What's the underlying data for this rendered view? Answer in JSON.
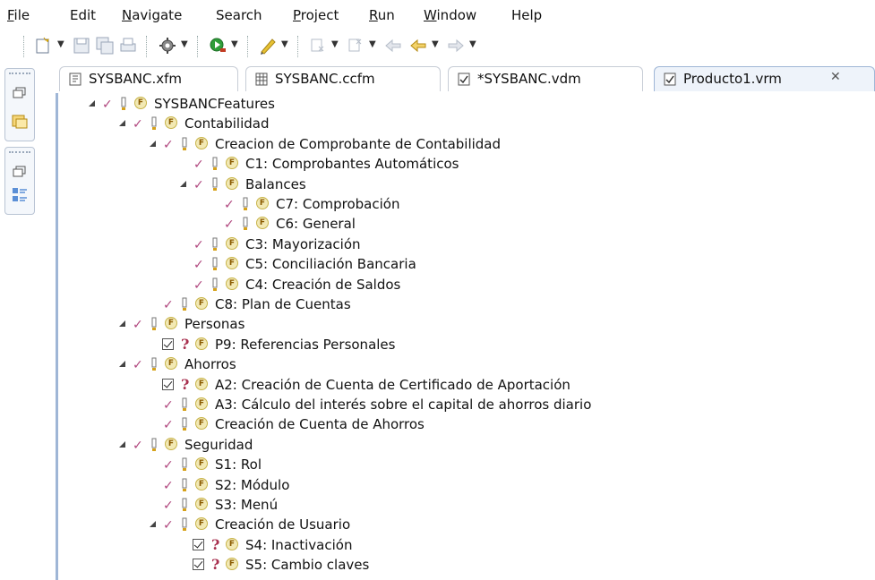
{
  "menu": [
    "File",
    "Edit",
    "Navigate",
    "Search",
    "Project",
    "Run",
    "Window",
    "Help"
  ],
  "tabs": [
    {
      "label": "SYSBANC.xfm",
      "icon": "feature-model-file-icon",
      "active": false
    },
    {
      "label": "SYSBANC.ccfm",
      "icon": "grid-file-icon",
      "active": false
    },
    {
      "label": "*SYSBANC.vdm",
      "icon": "variant-file-icon",
      "active": false
    },
    {
      "label": "Producto1.vrm",
      "icon": "variant-result-file-icon",
      "active": true,
      "close": "✕"
    }
  ],
  "tree": [
    {
      "label": "SYSBANCFeatures",
      "depth": 0,
      "expanded": true,
      "state": "check",
      "kind": "mandatory"
    },
    {
      "label": "Contabilidad",
      "depth": 1,
      "expanded": true,
      "state": "check",
      "kind": "mandatory"
    },
    {
      "label": "Creacion de Comprobante de Contabilidad",
      "depth": 2,
      "expanded": true,
      "state": "check",
      "kind": "mandatory"
    },
    {
      "label": "C1: Comprobantes Automáticos",
      "depth": 3,
      "expanded": false,
      "state": "check",
      "kind": "mandatory"
    },
    {
      "label": "Balances",
      "depth": 3,
      "expanded": true,
      "state": "check",
      "kind": "mandatory"
    },
    {
      "label": "C7: Comprobación",
      "depth": 4,
      "expanded": false,
      "state": "check",
      "kind": "mandatory"
    },
    {
      "label": "C6: General",
      "depth": 4,
      "expanded": false,
      "state": "check",
      "kind": "mandatory"
    },
    {
      "label": "C3: Mayorización",
      "depth": 3,
      "expanded": false,
      "state": "check",
      "kind": "mandatory"
    },
    {
      "label": "C5: Conciliación Bancaria",
      "depth": 3,
      "expanded": false,
      "state": "check",
      "kind": "mandatory"
    },
    {
      "label": "C4: Creación de Saldos",
      "depth": 3,
      "expanded": false,
      "state": "check",
      "kind": "mandatory"
    },
    {
      "label": "C8: Plan de Cuentas",
      "depth": 2,
      "expanded": false,
      "state": "check",
      "kind": "mandatory"
    },
    {
      "label": "Personas",
      "depth": 1,
      "expanded": true,
      "state": "check",
      "kind": "mandatory"
    },
    {
      "label": "P9: Referencias Personales",
      "depth": 2,
      "expanded": false,
      "state": "box",
      "kind": "optional"
    },
    {
      "label": "Ahorros",
      "depth": 1,
      "expanded": true,
      "state": "check",
      "kind": "mandatory"
    },
    {
      "label": "A2:  Creación de Cuenta de Certificado de Aportación",
      "depth": 2,
      "expanded": false,
      "state": "box",
      "kind": "optional"
    },
    {
      "label": "A3: Cálculo del interés sobre el capital de ahorros diario",
      "depth": 2,
      "expanded": false,
      "state": "check",
      "kind": "mandatory"
    },
    {
      "label": "Creación de Cuenta de Ahorros",
      "depth": 2,
      "expanded": false,
      "state": "check",
      "kind": "mandatory"
    },
    {
      "label": "Seguridad",
      "depth": 1,
      "expanded": true,
      "state": "check",
      "kind": "mandatory"
    },
    {
      "label": "S1: Rol",
      "depth": 2,
      "expanded": false,
      "state": "check",
      "kind": "mandatory"
    },
    {
      "label": "S2: Módulo",
      "depth": 2,
      "expanded": false,
      "state": "check",
      "kind": "mandatory"
    },
    {
      "label": "S3: Menú",
      "depth": 2,
      "expanded": false,
      "state": "check",
      "kind": "mandatory"
    },
    {
      "label": "Creación de Usuario",
      "depth": 2,
      "expanded": true,
      "state": "check",
      "kind": "mandatory"
    },
    {
      "label": "S4: Inactivación",
      "depth": 3,
      "expanded": false,
      "state": "box",
      "kind": "optional"
    },
    {
      "label": "S5: Cambio claves",
      "depth": 3,
      "expanded": false,
      "state": "box",
      "kind": "optional"
    }
  ],
  "icons": {
    "feature": "F",
    "checkmark": "✓",
    "optional": "?"
  },
  "colors": {
    "check": "#b0467e",
    "feature_fill": "#f2e9b4",
    "optional": "#a8304f",
    "editor_border": "#9fb6d6"
  }
}
